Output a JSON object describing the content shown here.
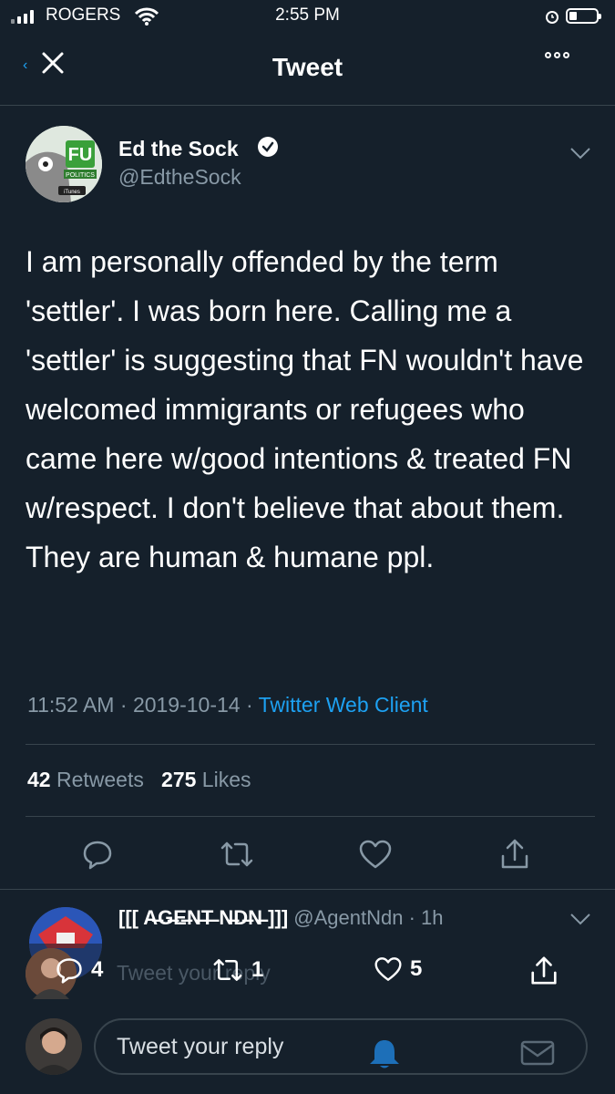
{
  "status_bar": {
    "carrier": "ROGERS",
    "time": "2:55 PM"
  },
  "header": {
    "title": "Tweet"
  },
  "tweet": {
    "author_name": "Ed the Sock",
    "author_handle": "@EdtheSock",
    "text": "I am personally offended by the term 'settler'. I was born here. Calling me a 'settler' is suggesting that FN wouldn't have welcomed immigrants or refugees who came here w/good intentions & treated FN w/respect. I don't believe that about them. They are human & humane ppl.",
    "time": "11:52 AM",
    "date": "2019-10-14",
    "client": "Twitter Web Client",
    "retweets_count": "42",
    "retweets_label": "Retweets",
    "likes_count": "275",
    "likes_label": "Likes"
  },
  "avatar_badge": {
    "logo_text": "FU",
    "sub_text": "POLITICS",
    "store_text": "iTunes"
  },
  "reply_preview": {
    "name": "[[[ A̶G̶E̶N̶T̶ N̶D̶N̶ ]]]",
    "handle": "@AgentNdn",
    "age": "1h"
  },
  "overlay_bar": {
    "replies": "4",
    "retweets": "1",
    "likes": "5",
    "ghost_text": "Tweet your reply"
  },
  "composer": {
    "placeholder": "Tweet your reply"
  },
  "colors": {
    "background": "#15202b",
    "accent": "#1da1f2",
    "muted": "#8899a6",
    "divider": "#38444d"
  },
  "icons": [
    "signal-icon",
    "wifi-icon",
    "alarm-icon",
    "battery-icon",
    "close-icon",
    "more-icon",
    "verified-icon",
    "chevron-down-icon",
    "reply-icon",
    "retweet-icon",
    "like-icon",
    "share-icon",
    "bell-icon",
    "mail-icon"
  ]
}
